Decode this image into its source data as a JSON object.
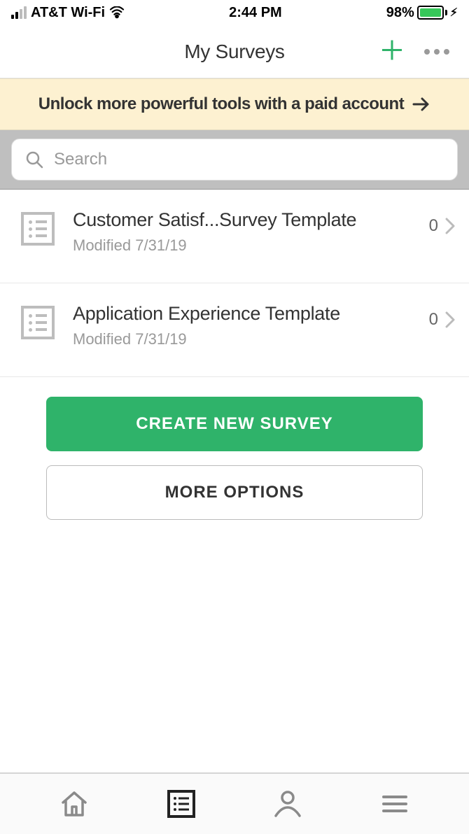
{
  "status": {
    "carrier": "AT&T Wi-Fi",
    "time": "2:44 PM",
    "battery_pct": "98%"
  },
  "header": {
    "title": "My Surveys"
  },
  "promo": {
    "text": "Unlock more powerful tools with a paid account"
  },
  "search": {
    "placeholder": "Search"
  },
  "surveys": [
    {
      "title": "Customer Satisf...Survey Template",
      "modified": "Modified 7/31/19",
      "count": "0"
    },
    {
      "title": "Application Experience Template",
      "modified": "Modified 7/31/19",
      "count": "0"
    }
  ],
  "actions": {
    "create": "CREATE NEW SURVEY",
    "more": "MORE OPTIONS"
  },
  "colors": {
    "accent_green": "#2fb36a",
    "add_green": "#2fb36a"
  }
}
